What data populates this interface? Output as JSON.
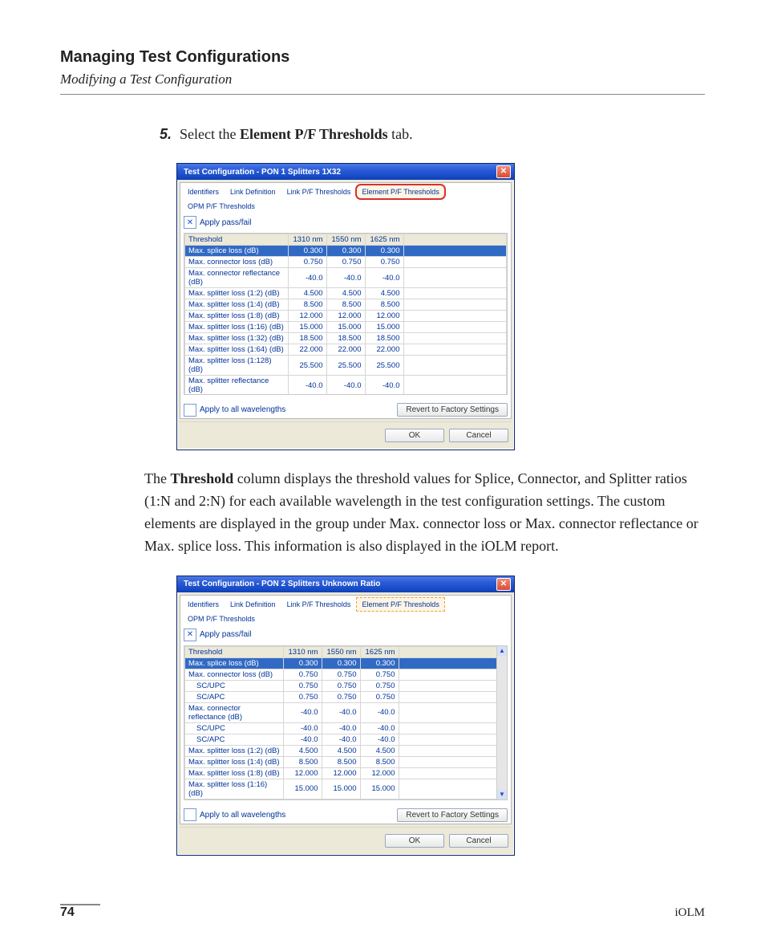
{
  "header": {
    "title": "Managing Test Configurations",
    "subtitle": "Modifying a Test Configuration"
  },
  "step": {
    "number": "5.",
    "pre": "Select the ",
    "bold": "Element P/F Thresholds",
    "post": " tab."
  },
  "dialog1": {
    "title": "Test Configuration - PON 1 Splitters 1X32",
    "tabs": [
      "Identifiers",
      "Link Definition",
      "Link P/F Thresholds",
      "Element P/F Thresholds",
      "OPM P/F Thresholds"
    ],
    "apply_pf": "Apply pass/fail",
    "headers": [
      "Threshold",
      "1310 nm",
      "1550 nm",
      "1625 nm"
    ],
    "rows": [
      {
        "label": "Max. splice loss (dB)",
        "v": [
          "0.300",
          "0.300",
          "0.300"
        ],
        "sel": true
      },
      {
        "label": "Max. connector loss (dB)",
        "v": [
          "0.750",
          "0.750",
          "0.750"
        ]
      },
      {
        "label": "Max. connector reflectance (dB)",
        "v": [
          "-40.0",
          "-40.0",
          "-40.0"
        ]
      },
      {
        "label": "Max. splitter loss (1:2) (dB)",
        "v": [
          "4.500",
          "4.500",
          "4.500"
        ]
      },
      {
        "label": "Max. splitter loss (1:4) (dB)",
        "v": [
          "8.500",
          "8.500",
          "8.500"
        ]
      },
      {
        "label": "Max. splitter loss (1:8) (dB)",
        "v": [
          "12.000",
          "12.000",
          "12.000"
        ]
      },
      {
        "label": "Max. splitter loss (1:16) (dB)",
        "v": [
          "15.000",
          "15.000",
          "15.000"
        ]
      },
      {
        "label": "Max. splitter loss (1:32) (dB)",
        "v": [
          "18.500",
          "18.500",
          "18.500"
        ]
      },
      {
        "label": "Max. splitter loss (1:64) (dB)",
        "v": [
          "22.000",
          "22.000",
          "22.000"
        ]
      },
      {
        "label": "Max. splitter loss (1:128) (dB)",
        "v": [
          "25.500",
          "25.500",
          "25.500"
        ]
      },
      {
        "label": "Max. splitter reflectance (dB)",
        "v": [
          "-40.0",
          "-40.0",
          "-40.0"
        ]
      }
    ],
    "apply_all": "Apply to all wavelengths",
    "revert": "Revert to Factory Settings",
    "ok": "OK",
    "cancel": "Cancel"
  },
  "paragraph": {
    "pre": "The ",
    "bold": "Threshold",
    "post": " column displays the threshold values for Splice, Connector, and Splitter ratios (1:N and 2:N) for each available wavelength in the test configuration settings. The custom elements are displayed in the group under Max. connector loss or Max. connector reflectance or Max. splice loss. This information is also displayed in the iOLM report."
  },
  "dialog2": {
    "title": "Test Configuration - PON 2 Splitters Unknown Ratio",
    "tabs": [
      "Identifiers",
      "Link Definition",
      "Link P/F Thresholds",
      "Element P/F Thresholds",
      "OPM P/F Thresholds"
    ],
    "apply_pf": "Apply pass/fail",
    "headers": [
      "Threshold",
      "1310 nm",
      "1550 nm",
      "1625 nm"
    ],
    "rows": [
      {
        "label": "Max. splice loss (dB)",
        "v": [
          "0.300",
          "0.300",
          "0.300"
        ],
        "sel": true
      },
      {
        "label": "Max. connector loss (dB)",
        "v": [
          "0.750",
          "0.750",
          "0.750"
        ]
      },
      {
        "label": "SC/UPC",
        "v": [
          "0.750",
          "0.750",
          "0.750"
        ],
        "indent": true
      },
      {
        "label": "SC/APC",
        "v": [
          "0.750",
          "0.750",
          "0.750"
        ],
        "indent": true
      },
      {
        "label": "Max. connector reflectance (dB)",
        "v": [
          "-40.0",
          "-40.0",
          "-40.0"
        ]
      },
      {
        "label": "SC/UPC",
        "v": [
          "-40.0",
          "-40.0",
          "-40.0"
        ],
        "indent": true
      },
      {
        "label": "SC/APC",
        "v": [
          "-40.0",
          "-40.0",
          "-40.0"
        ],
        "indent": true
      },
      {
        "label": "Max. splitter loss (1:2) (dB)",
        "v": [
          "4.500",
          "4.500",
          "4.500"
        ]
      },
      {
        "label": "Max. splitter loss (1:4) (dB)",
        "v": [
          "8.500",
          "8.500",
          "8.500"
        ]
      },
      {
        "label": "Max. splitter loss (1:8) (dB)",
        "v": [
          "12.000",
          "12.000",
          "12.000"
        ]
      },
      {
        "label": "Max. splitter loss (1:16) (dB)",
        "v": [
          "15.000",
          "15.000",
          "15.000"
        ]
      }
    ],
    "apply_all": "Apply to all wavelengths",
    "revert": "Revert to Factory Settings",
    "ok": "OK",
    "cancel": "Cancel"
  },
  "footer": {
    "page": "74",
    "product": "iOLM"
  }
}
